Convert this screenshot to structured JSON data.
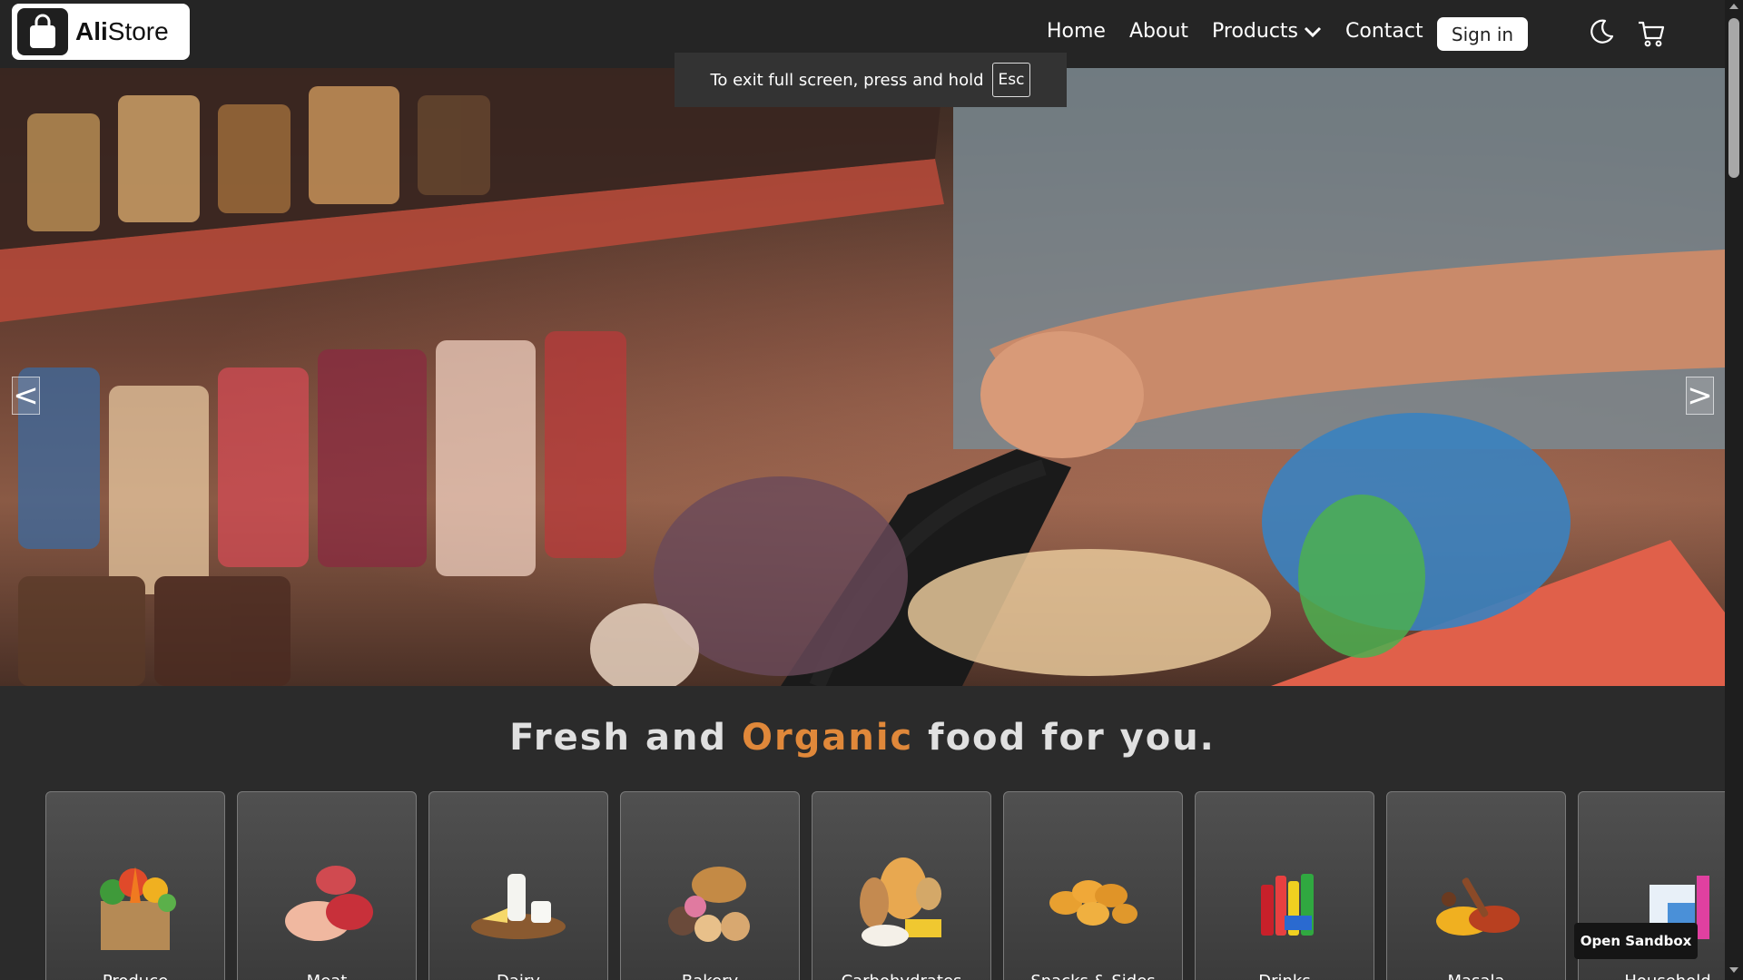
{
  "brand": {
    "bold": "Ali",
    "regular": "Store"
  },
  "nav": {
    "home": "Home",
    "about": "About",
    "products": "Products",
    "contact": "Contact",
    "signin": "Sign in"
  },
  "fullscreen_toast": {
    "text": "To exit full screen, press and hold",
    "key": "Esc"
  },
  "hero": {
    "prev": "<",
    "next": ">"
  },
  "tagline": {
    "part1": "Fresh and ",
    "accent": "Organic",
    "part2": " food for you."
  },
  "categories": [
    {
      "label": "Produce",
      "icon": "produce-icon"
    },
    {
      "label": "Meat",
      "icon": "meat-icon"
    },
    {
      "label": "Dairy",
      "icon": "dairy-icon"
    },
    {
      "label": "Bakery",
      "icon": "bakery-icon"
    },
    {
      "label": "Carbohydrates",
      "icon": "carbs-icon"
    },
    {
      "label": "Snacks & Sides",
      "icon": "snacks-icon"
    },
    {
      "label": "Drinks",
      "icon": "drinks-icon"
    },
    {
      "label": "Masala",
      "icon": "masala-icon"
    },
    {
      "label": "Household",
      "icon": "household-icon"
    }
  ],
  "sandbox": "Open Sandbox",
  "colors": {
    "accent": "#e0883a",
    "background": "#2b2b2b",
    "navbar": "#252525"
  }
}
